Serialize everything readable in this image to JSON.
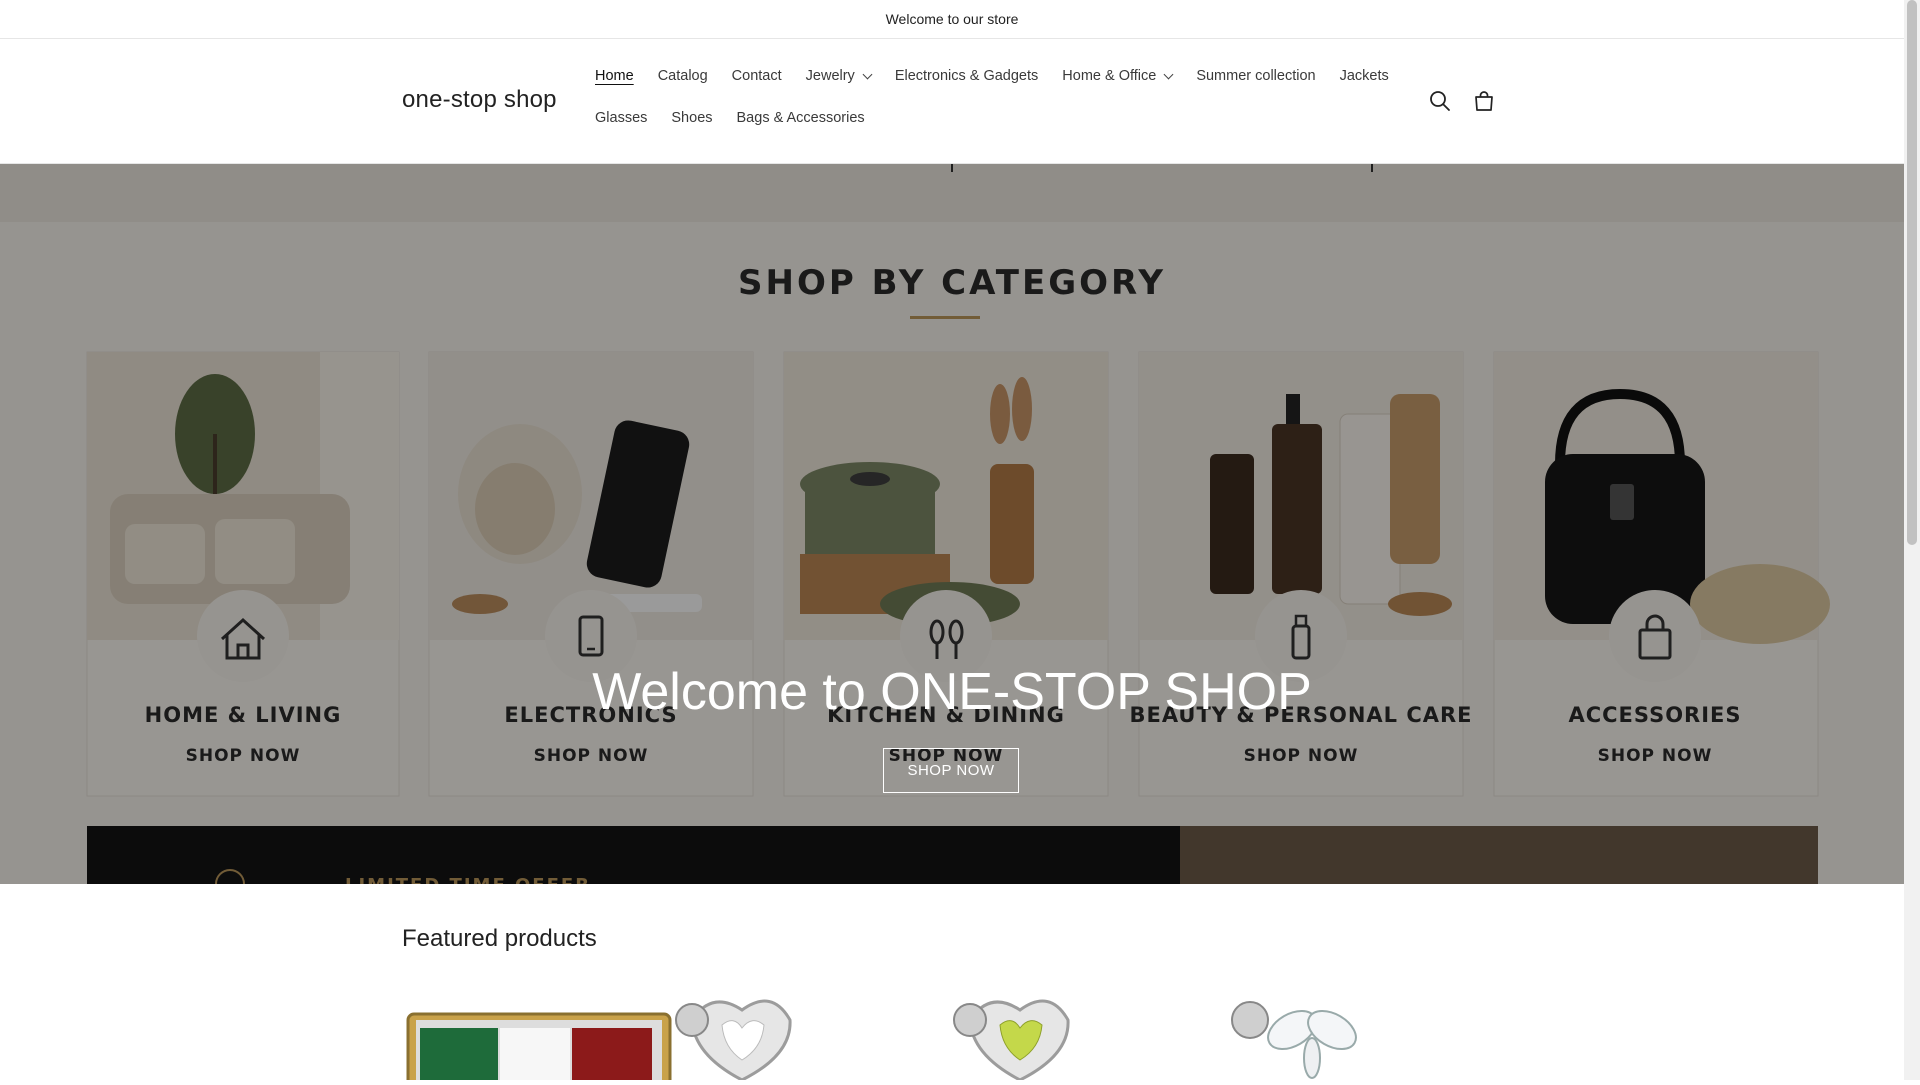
{
  "announcement": "Welcome to our store",
  "logo": "one-stop shop",
  "nav": {
    "row1": [
      {
        "label": "Home",
        "active": true,
        "dropdown": false
      },
      {
        "label": "Catalog",
        "dropdown": false
      },
      {
        "label": "Contact",
        "dropdown": false
      },
      {
        "label": "Jewelry",
        "dropdown": true
      },
      {
        "label": "Electronics & Gadgets",
        "dropdown": false
      },
      {
        "label": "Home & Office",
        "dropdown": true
      },
      {
        "label": "Summer collection",
        "dropdown": false
      },
      {
        "label": "Jackets",
        "dropdown": false
      }
    ],
    "row2": [
      {
        "label": "Glasses"
      },
      {
        "label": "Shoes"
      },
      {
        "label": "Bags & Accessories"
      }
    ]
  },
  "header_icons": [
    "search-icon",
    "cart-icon"
  ],
  "hero": {
    "title": "Welcome to ONE-STOP SHOP",
    "button": "SHOP NOW",
    "banner_heading": "SHOP BY CATEGORY",
    "categories": [
      {
        "name": "HOME & LIVING",
        "cta": "SHOP NOW",
        "icon": "house-icon"
      },
      {
        "name": "ELECTRONICS",
        "cta": "SHOP NOW",
        "icon": "phone-icon"
      },
      {
        "name": "KITCHEN & DINING",
        "cta": "SHOP NOW",
        "icon": "utensils-icon"
      },
      {
        "name": "BEAUTY & PERSONAL CARE",
        "cta": "SHOP NOW",
        "icon": "bottle-icon"
      },
      {
        "name": "ACCESSORIES",
        "cta": "SHOP NOW",
        "icon": "bag-icon"
      }
    ],
    "promo_text": "LIMITED TIME OFFER"
  },
  "featured": {
    "title": "Featured products"
  },
  "colors": {
    "overlay": "#000000",
    "banner_accent": "#b8955a",
    "promo_bg": "#141414"
  }
}
